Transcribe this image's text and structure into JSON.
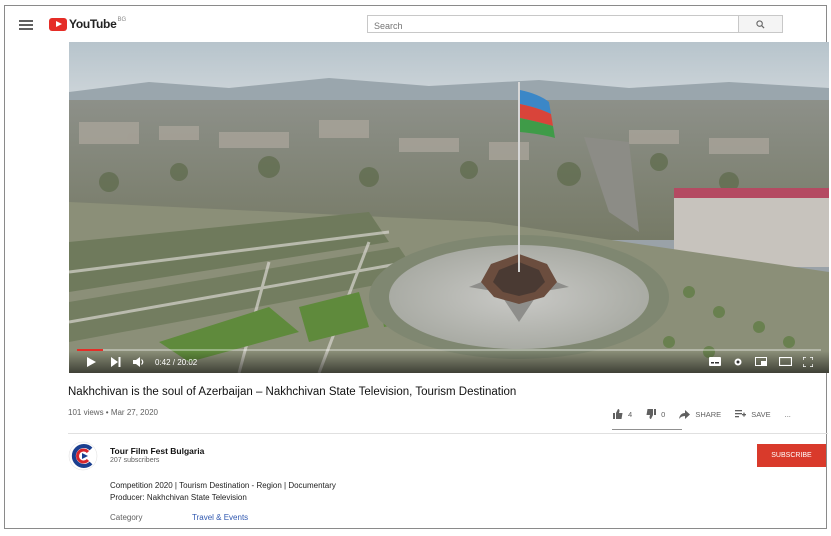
{
  "header": {
    "logo_text": "YouTube",
    "logo_region": "BG",
    "search_placeholder": "Search"
  },
  "player": {
    "time": "0:42 / 20:02",
    "progress_fraction": 0.035
  },
  "video": {
    "title": "Nakhchivan is the soul of Azerbaijan – Nakhchivan State Television, Tourism Destination",
    "meta": "101 views • Mar 27, 2020",
    "likes": "4",
    "dislikes": "0",
    "share_label": "SHARE",
    "save_label": "SAVE",
    "more_label": "..."
  },
  "channel": {
    "name": "Tour Film Fest Bulgaria",
    "subscribers": "207 subscribers",
    "subscribe_label": "SUBSCRIBE"
  },
  "description": {
    "line1": "Competition 2020 | Tourism Destination - Region | Documentary",
    "line2": "Producer: Nakhchivan State Television",
    "category_label": "Category",
    "category_value": "Travel & Events"
  },
  "colors": {
    "accent_red": "#e52d27",
    "subscribe_red": "#d93a2b",
    "link_blue": "#3058b0"
  }
}
